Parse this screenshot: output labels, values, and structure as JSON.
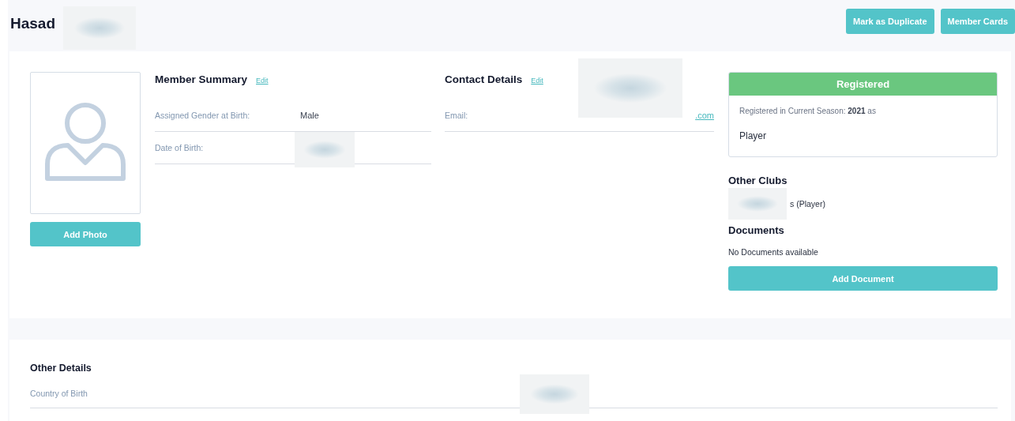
{
  "header": {
    "title": "Hasad",
    "buttons": [
      "Mark as Duplicate",
      "Member Cards"
    ]
  },
  "photo": {
    "button": "Add Photo"
  },
  "member_summary": {
    "title": "Member Summary",
    "edit": "Edit",
    "fields": [
      {
        "label": "Assigned Gender at Birth:",
        "value": "Male"
      },
      {
        "label": "Date of Birth:"
      }
    ]
  },
  "contact_details": {
    "title": "Contact Details",
    "edit": "Edit",
    "fields": [
      {
        "label": "Email:",
        "value": ".com",
        "kind": "link"
      }
    ]
  },
  "registration": {
    "status": "Registered",
    "text": "Registered in Current Season: **2021** as",
    "role": "Player"
  },
  "other_clubs": {
    "title": "Other Clubs",
    "items": [
      "s (Player)"
    ]
  },
  "documents": {
    "title": "Documents",
    "empty": "No Documents available",
    "button": "Add Document"
  },
  "other_details": {
    "title": "Other Details",
    "fields": [
      {
        "label": "Country of Birth"
      }
    ]
  }
}
